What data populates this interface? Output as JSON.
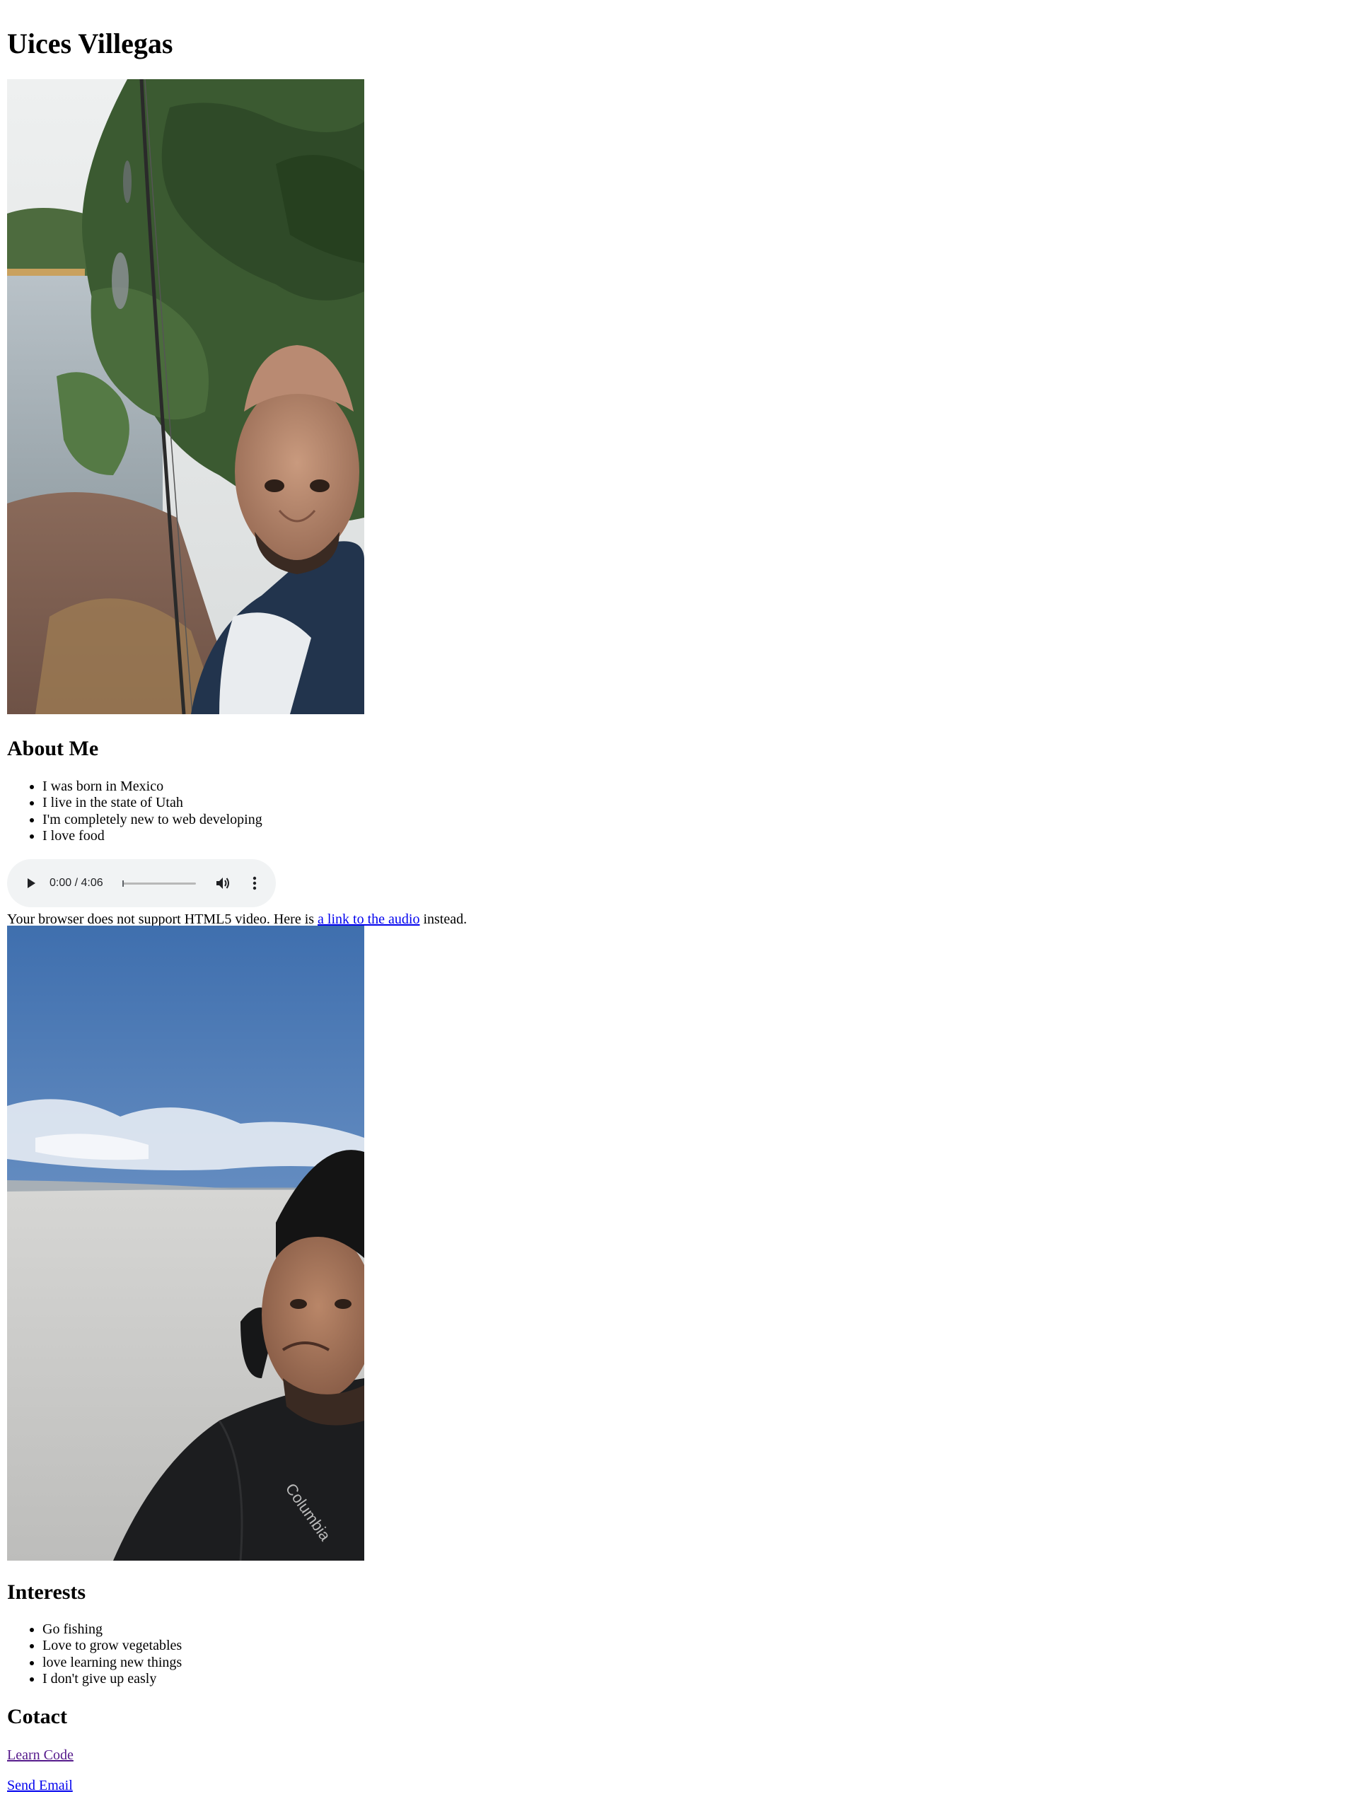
{
  "title": "Uices Villegas",
  "photo1": {
    "alt": "selfie by a lake with pine tree and fishing rod"
  },
  "about": {
    "heading": "About Me",
    "items": [
      "I was born in Mexico",
      "I live in the state of Utah",
      "I'm completely new to web developing",
      "I love food"
    ]
  },
  "audio": {
    "time": "0:00 / 4:06",
    "progress": 0,
    "icons": [
      "play-icon",
      "volume-icon",
      "more-options-icon"
    ]
  },
  "fallback": {
    "before": "Your browser does not support HTML5 video. Here is ",
    "link": "a link to the audio",
    "after": " instead."
  },
  "photo2": {
    "alt": "selfie on salt flats under blue sky"
  },
  "interests": {
    "heading": "Interests",
    "items": [
      "Go fishing",
      "Love to grow vegetables",
      "love learning new things",
      "I don't give up easly"
    ]
  },
  "contact": {
    "heading": "Cotact",
    "links": [
      "Learn Code",
      "Send Email"
    ]
  },
  "photo2_watermark": "Columbia",
  "colors": {
    "link": "#0000ee",
    "visited_link": "#551a8b",
    "audio_bg": "#f1f3f4"
  }
}
